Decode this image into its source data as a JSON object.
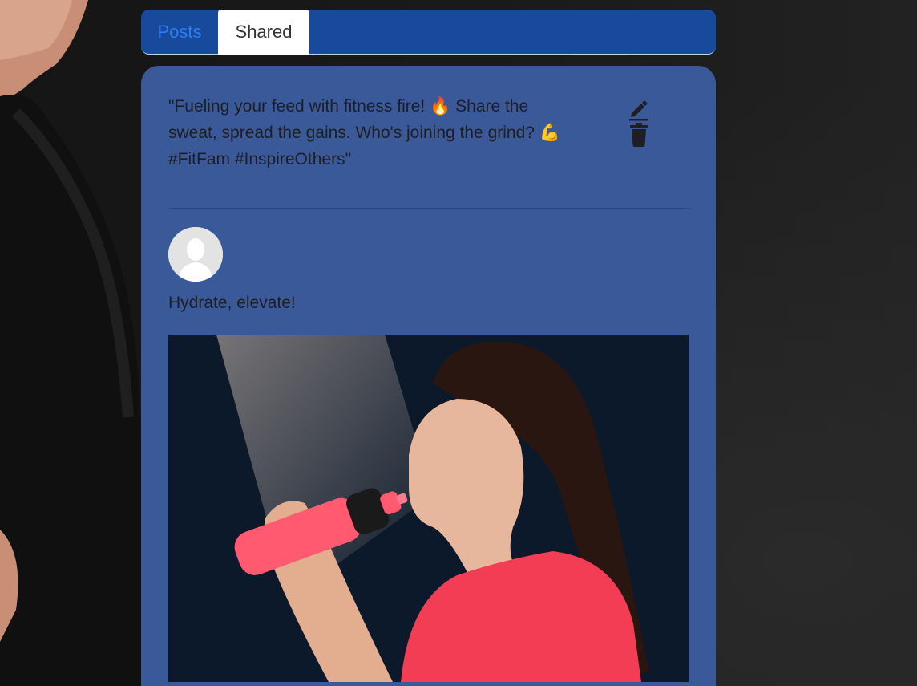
{
  "tabs": [
    {
      "label": "Posts",
      "active": false
    },
    {
      "label": "Shared",
      "active": true
    }
  ],
  "shared_post": {
    "caption": "\"Fueling your feed with fitness fire! 🔥 Share the\nsweat, spread the gains. Who's joining the grind? 💪\n#FitFam #InspireOthers\"",
    "edit_icon": "pencil-icon",
    "delete_icon": "trash-icon"
  },
  "original_post": {
    "avatar_icon": "default-user-avatar",
    "text": "Hydrate, elevate!",
    "image_description_icon": "photo"
  },
  "colors": {
    "tab_bar": "#174a9a",
    "tab_active_text": "#333333",
    "tab_inactive_text": "#2f7cf6",
    "card_bg": "#3a5998",
    "page_bg": "#141414"
  }
}
